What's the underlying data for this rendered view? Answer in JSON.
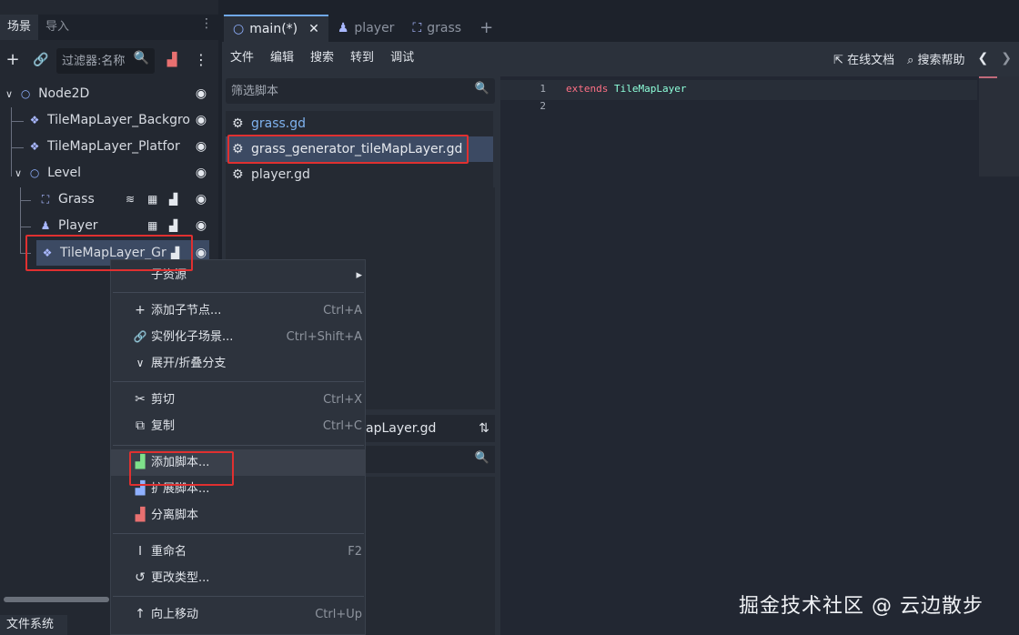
{
  "left_dock": {
    "tabs": [
      "场景",
      "导入"
    ],
    "filter_placeholder": "过滤器:名称",
    "tree": [
      {
        "name": "Node2D",
        "icon": "circle-node-icon",
        "color": "#8fb0ff"
      },
      {
        "name": "TileMapLayer_Backgro",
        "icon": "tilemap-icon",
        "color": "#a9b8ff"
      },
      {
        "name": "TileMapLayer_Platfor",
        "icon": "tilemap-icon",
        "color": "#a9b8ff"
      },
      {
        "name": "Level",
        "icon": "circle-node-icon",
        "color": "#8fb0ff"
      },
      {
        "name": "Grass",
        "icon": "area-node-icon",
        "color": "#a9b8ff"
      },
      {
        "name": "Player",
        "icon": "character-icon",
        "color": "#a9b8ff"
      },
      {
        "name": "TileMapLayer_Gr",
        "icon": "tilemap-icon",
        "color": "#a9b8ff"
      }
    ],
    "filesystem_tab": "文件系统"
  },
  "top_tabs": [
    {
      "label": "main(*)",
      "active": true
    },
    {
      "label": "player",
      "active": false
    },
    {
      "label": "grass",
      "active": false
    }
  ],
  "menubar": [
    "文件",
    "编辑",
    "搜索",
    "转到",
    "调试"
  ],
  "help": {
    "online_docs": "在线文档",
    "search_help": "搜索帮助"
  },
  "script_panel": {
    "filter_placeholder": "筛选脚本",
    "scripts": [
      {
        "name": "grass.gd",
        "color": "#7fb2ef"
      },
      {
        "name": "grass_generator_tileMapLayer.gd",
        "color": "#e6e9ee"
      },
      {
        "name": "player.gd",
        "color": "#d7dbe2"
      }
    ],
    "method_title": "apLayer.gd"
  },
  "editor": {
    "lines": [
      {
        "num": "1",
        "keyword": "extends",
        "type": "TileMapLayer"
      },
      {
        "num": "2",
        "keyword": "",
        "type": ""
      }
    ],
    "colors": {
      "keyword": "#ff7085",
      "type": "#8effda"
    }
  },
  "context_menu": {
    "items": [
      {
        "icon": "",
        "label": "子资源",
        "shortcut": "",
        "submenu": true
      },
      {
        "icon": "plus-icon",
        "label": "添加子节点...",
        "shortcut": "Ctrl+A"
      },
      {
        "icon": "link-icon",
        "label": "实例化子场景...",
        "shortcut": "Ctrl+Shift+A"
      },
      {
        "icon": "chevron-down-icon",
        "label": "展开/折叠分支",
        "shortcut": ""
      },
      {
        "icon": "scissors-icon",
        "label": "剪切",
        "shortcut": "Ctrl+X"
      },
      {
        "icon": "copy-icon",
        "label": "复制",
        "shortcut": "Ctrl+C"
      },
      {
        "icon": "script-add-icon",
        "label": "添加脚本...",
        "shortcut": ""
      },
      {
        "icon": "script-extend-icon",
        "label": "扩展脚本...",
        "shortcut": ""
      },
      {
        "icon": "script-remove-icon",
        "label": "分离脚本",
        "shortcut": ""
      },
      {
        "icon": "rename-icon",
        "label": "重命名",
        "shortcut": "F2"
      },
      {
        "icon": "change-type-icon",
        "label": "更改类型...",
        "shortcut": ""
      },
      {
        "icon": "move-up-icon",
        "label": "向上移动",
        "shortcut": "Ctrl+Up"
      }
    ]
  },
  "watermark": "掘金技术社区 @ 云边散步",
  "accent_color": "#e03030"
}
